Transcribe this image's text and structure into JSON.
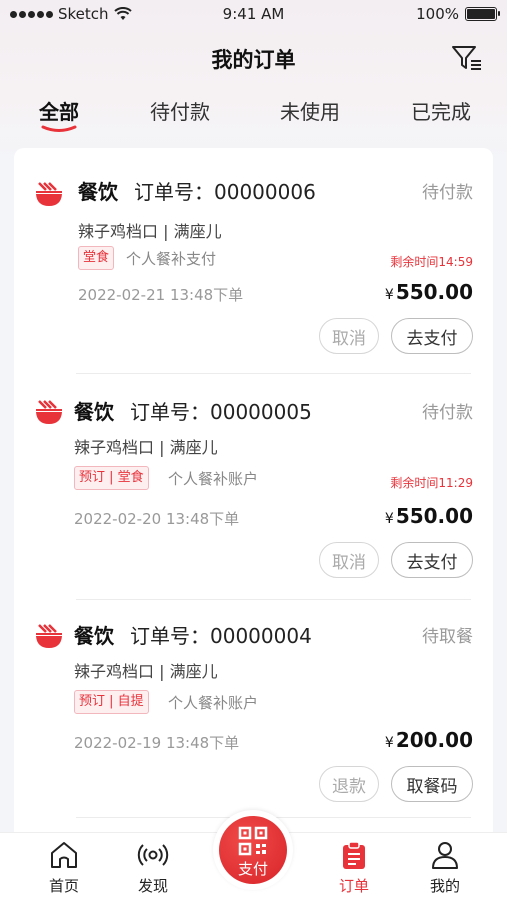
{
  "status_bar": {
    "carrier": "Sketch",
    "time": "9:41 AM",
    "battery": "100%"
  },
  "header": {
    "title": "我的订单",
    "filter_icon": "filter-icon"
  },
  "tabs": [
    {
      "label": "全部",
      "active": true
    },
    {
      "label": "待付款",
      "active": false
    },
    {
      "label": "未使用",
      "active": false
    },
    {
      "label": "已完成",
      "active": false
    }
  ],
  "orders": [
    {
      "category": "餐饮",
      "order_no": "订单号：00000006",
      "status": "待付款",
      "shop": "辣子鸡档口 | 满座儿",
      "tag": "堂食",
      "pay_type": "个人餐补支付",
      "remaining": "剩余时间14:59",
      "datetime": "2022-02-21  13:48下单",
      "currency": "¥",
      "price": "550.00",
      "secondary_button": "取消",
      "primary_button": "去支付"
    },
    {
      "category": "餐饮",
      "order_no": "订单号：00000005",
      "status": "待付款",
      "shop": "辣子鸡档口 | 满座儿",
      "tag": "预订 | 堂食",
      "pay_type": "个人餐补账户",
      "remaining": "剩余时间11:29",
      "datetime": "2022-02-20  13:48下单",
      "currency": "¥",
      "price": "550.00",
      "secondary_button": "取消",
      "primary_button": "去支付"
    },
    {
      "category": "餐饮",
      "order_no": "订单号：00000004",
      "status": "待取餐",
      "shop": "辣子鸡档口 | 满座儿",
      "tag": "预订 | 自提",
      "pay_type": "个人餐补账户",
      "remaining": "",
      "datetime": "2022-02-19  13:48下单",
      "currency": "¥",
      "price": "200.00",
      "secondary_button": "退款",
      "primary_button": "取餐码"
    }
  ],
  "tabbar": {
    "home": "首页",
    "discover": "发现",
    "pay": "支付",
    "orders": "订单",
    "mine": "我的"
  },
  "colors": {
    "accent": "#e8333a",
    "text": "#222222",
    "muted": "#999999"
  }
}
